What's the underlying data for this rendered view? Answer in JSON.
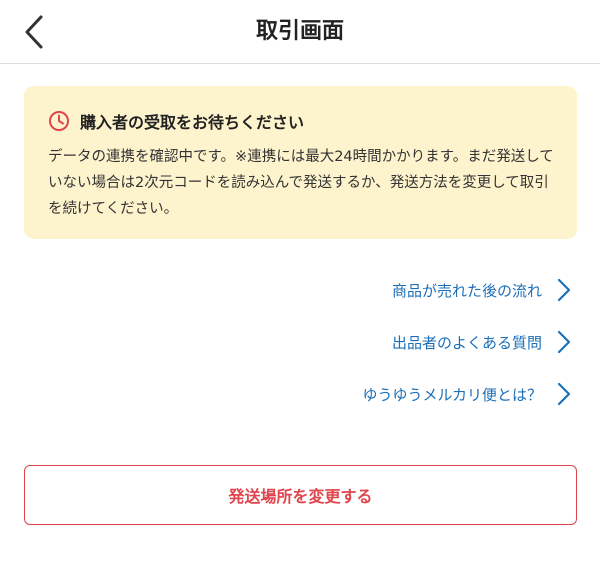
{
  "header": {
    "title": "取引画面",
    "back_icon": "chevron-left-icon"
  },
  "notice": {
    "icon": "clock-icon",
    "title": "購入者の受取をお待ちください",
    "body": "データの連携を確認中です。※連携には最大24時間かかります。まだ発送していない場合は2次元コードを読み込んで発送するか、発送方法を変更して取引を続けてください。",
    "background_color": "#fdf3cd",
    "icon_color": "#e0444c"
  },
  "links": [
    {
      "label": "商品が売れた後の流れ",
      "icon": "chevron-right-icon"
    },
    {
      "label": "出品者のよくある質問",
      "icon": "chevron-right-icon"
    },
    {
      "label": "ゆうゆうメルカリ便とは？",
      "icon": "chevron-right-icon"
    }
  ],
  "link_color": "#1d6fb8",
  "change_button": {
    "label": "発送場所を変更する",
    "color": "#e0444c"
  }
}
